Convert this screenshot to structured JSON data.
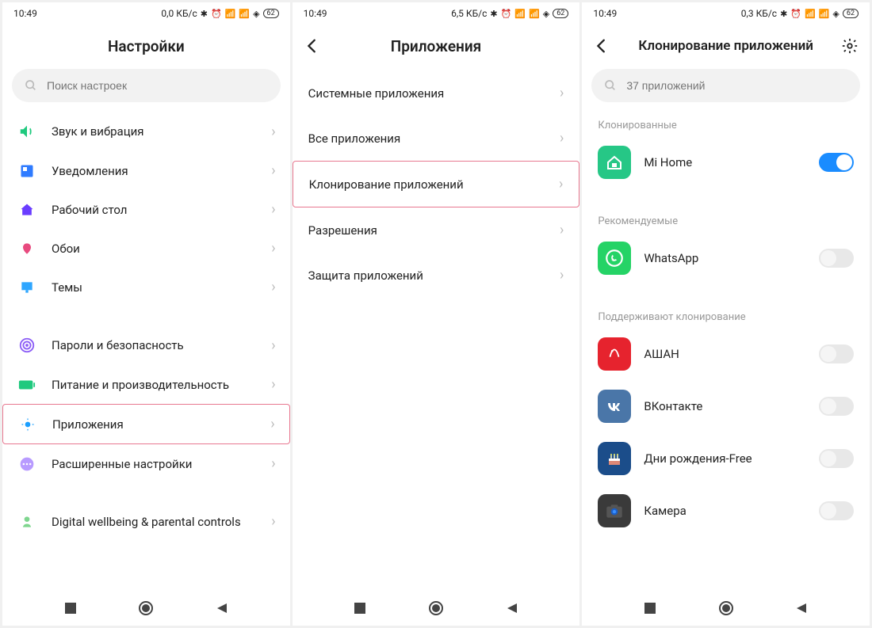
{
  "screen1": {
    "time": "10:49",
    "net": "0,0 КБ/с",
    "batt": "62",
    "title": "Настройки",
    "search_placeholder": "Поиск настроек",
    "items": [
      {
        "label": "Звук и вибрация"
      },
      {
        "label": "Уведомления"
      },
      {
        "label": "Рабочий стол"
      },
      {
        "label": "Обои"
      },
      {
        "label": "Темы"
      },
      {
        "label": "Пароли и безопасность"
      },
      {
        "label": "Питание и производительность"
      },
      {
        "label": "Приложения"
      },
      {
        "label": "Расширенные настройки"
      },
      {
        "label": "Digital wellbeing & parental controls"
      }
    ]
  },
  "screen2": {
    "time": "10:49",
    "net": "6,5 КБ/с",
    "batt": "62",
    "title": "Приложения",
    "items": [
      {
        "label": "Системные приложения"
      },
      {
        "label": "Все приложения"
      },
      {
        "label": "Клонирование приложений"
      },
      {
        "label": "Разрешения"
      },
      {
        "label": "Защита приложений"
      }
    ]
  },
  "screen3": {
    "time": "10:49",
    "net": "0,3 КБ/с",
    "batt": "62",
    "title": "Клонирование приложений",
    "search_placeholder": "37 приложений",
    "sec_cloned": "Клонированные",
    "sec_recommended": "Рекомендуемые",
    "sec_supported": "Поддерживают клонирование",
    "apps_cloned": [
      {
        "label": "Mi Home"
      }
    ],
    "apps_recommended": [
      {
        "label": "WhatsApp"
      }
    ],
    "apps_supported": [
      {
        "label": "АШАН"
      },
      {
        "label": "ВКонтакте"
      },
      {
        "label": "Дни рождения-Free"
      },
      {
        "label": "Камера"
      }
    ]
  }
}
